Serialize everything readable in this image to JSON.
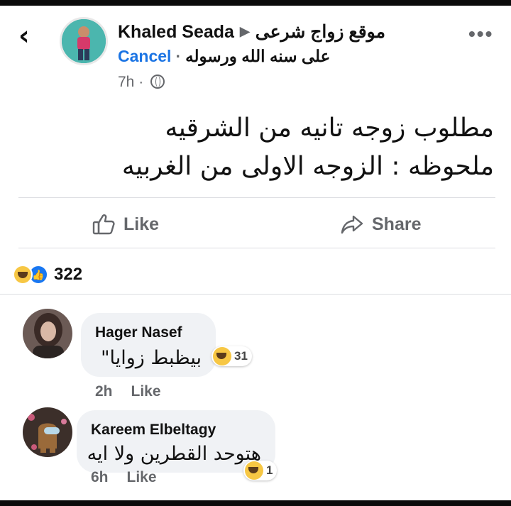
{
  "header": {
    "back_glyph": "‹",
    "author": "Khaled Seada",
    "group": "موقع زواج شرعى",
    "cancel_label": "Cancel",
    "subtitle": "على سنه الله ورسوله",
    "time": "7h",
    "more_glyph": "•••"
  },
  "post": {
    "line1": "مطلوب زوجه تانيه من الشرقيه",
    "line2": "ملحوظه :  الزوجه الاولى من الغربيه"
  },
  "actions": {
    "like_label": "Like",
    "share_label": "Share"
  },
  "reactions": {
    "count": "322",
    "icons": [
      "haha-icon",
      "like-icon"
    ]
  },
  "comments": [
    {
      "name": "Hager Nasef",
      "text": "بيظبط زوايا\"",
      "reaction_count": "31",
      "time": "2h",
      "like_label": "Like"
    },
    {
      "name": "Kareem Elbeltagy",
      "text": "هتوحد القطرين ولا ايه",
      "reaction_count": "1",
      "time": "6h",
      "like_label": "Like"
    }
  ],
  "colors": {
    "accent": "#1b74e4",
    "secondary_text": "#65676b",
    "bubble": "#f0f2f5"
  }
}
